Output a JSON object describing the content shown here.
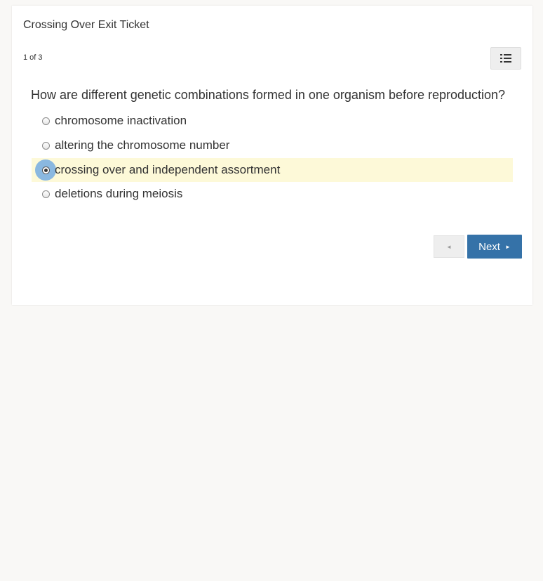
{
  "quiz": {
    "title": "Crossing Over Exit Ticket",
    "counter": "1 of 3",
    "list_icon": "list-icon"
  },
  "question": {
    "text": "How are different genetic combinations formed in one organism before reproduction?",
    "options": [
      {
        "label": "chromosome inactivation",
        "selected": false
      },
      {
        "label": "altering the chromosome number",
        "selected": false
      },
      {
        "label": "crossing over and independent assortment",
        "selected": true
      },
      {
        "label": "deletions during meiosis",
        "selected": false
      }
    ]
  },
  "nav": {
    "prev_arrow": "◄",
    "next_label": "Next",
    "next_arrow": "►"
  },
  "colors": {
    "next_button": "#3572a8",
    "selected_highlight": "#fdf9d8",
    "radio_focus": "#8ab8e0"
  }
}
